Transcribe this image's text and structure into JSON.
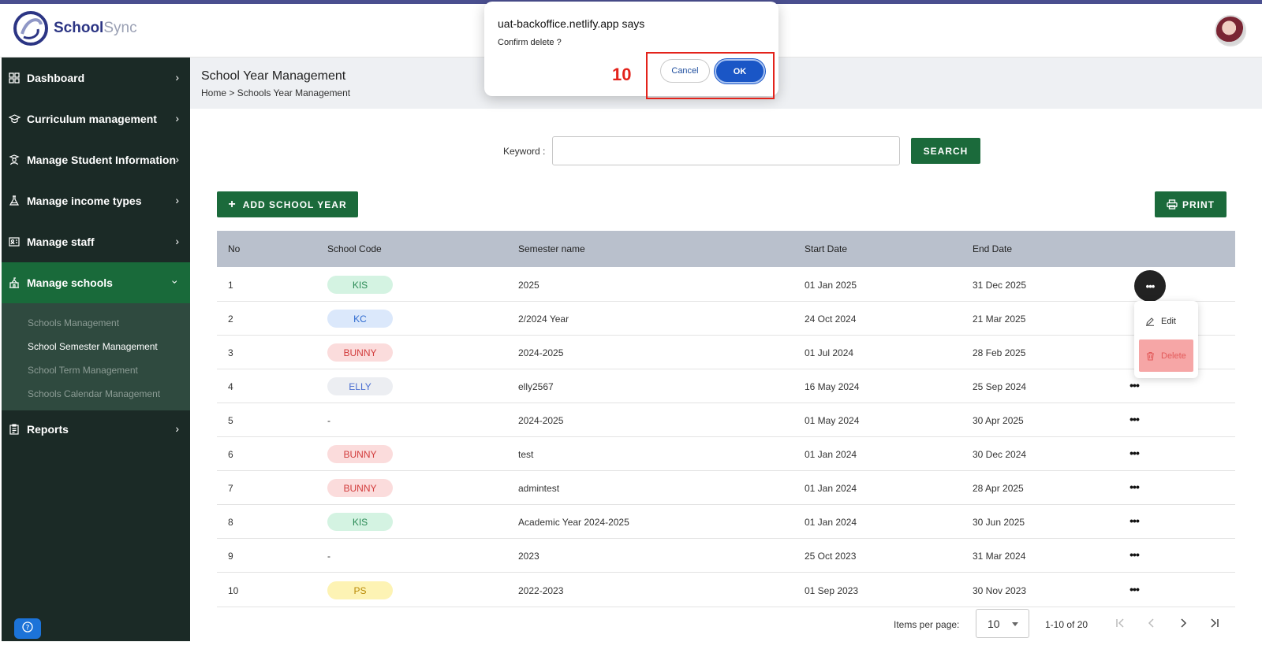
{
  "app": {
    "logo_primary": "School",
    "logo_secondary": "Sync"
  },
  "sidebar": {
    "items": [
      {
        "label": "Dashboard",
        "icon": "grid-icon"
      },
      {
        "label": "Curriculum management",
        "icon": "graduation-cap-icon"
      },
      {
        "label": "Manage Student Information",
        "icon": "student-icon"
      },
      {
        "label": "Manage income types",
        "icon": "flask-icon"
      },
      {
        "label": "Manage staff",
        "icon": "staff-board-icon"
      },
      {
        "label": "Manage schools",
        "icon": "school-icon",
        "active": true
      },
      {
        "label": "Reports",
        "icon": "clipboard-icon"
      }
    ],
    "submenu": [
      {
        "label": "Schools Management"
      },
      {
        "label": "School Semester Management",
        "active": true
      },
      {
        "label": "School Term Management"
      },
      {
        "label": "Schools Calendar Management"
      }
    ]
  },
  "header": {
    "page_title": "School Year Management",
    "breadcrumb": "Home > Schools Year Management"
  },
  "search": {
    "label": "Keyword :",
    "value": "",
    "button": "SEARCH"
  },
  "actions": {
    "add_label": "ADD SCHOOL YEAR",
    "print_label": "PRINT"
  },
  "table": {
    "columns": [
      "No",
      "School Code",
      "Semester name",
      "Start Date",
      "End Date"
    ],
    "rows": [
      {
        "no": "1",
        "code": "KIS",
        "semester": "2025",
        "start": "01 Jan 2025",
        "end": "31 Dec 2025"
      },
      {
        "no": "2",
        "code": "KC",
        "semester": "2/2024 Year",
        "start": "24 Oct 2024",
        "end": "21 Mar 2025"
      },
      {
        "no": "3",
        "code": "BUNNY",
        "semester": "2024-2025",
        "start": "01 Jul 2024",
        "end": "28 Feb 2025"
      },
      {
        "no": "4",
        "code": "ELLY",
        "semester": "elly2567",
        "start": "16 May 2024",
        "end": "25 Sep 2024"
      },
      {
        "no": "5",
        "code": "-",
        "semester": "2024-2025",
        "start": "01 May 2024",
        "end": "30 Apr 2025"
      },
      {
        "no": "6",
        "code": "BUNNY",
        "semester": "test",
        "start": "01 Jan 2024",
        "end": "30 Dec 2024"
      },
      {
        "no": "7",
        "code": "BUNNY",
        "semester": "admintest",
        "start": "01 Jan 2024",
        "end": "28 Apr 2025"
      },
      {
        "no": "8",
        "code": "KIS",
        "semester": "Academic Year 2024-2025",
        "start": "01 Jan 2024",
        "end": "30 Jun 2025"
      },
      {
        "no": "9",
        "code": "-",
        "semester": "2023",
        "start": "25 Oct 2023",
        "end": "31 Mar 2024"
      },
      {
        "no": "10",
        "code": "PS",
        "semester": "2022-2023",
        "start": "01 Sep 2023",
        "end": "30 Nov 2023"
      }
    ]
  },
  "row_menu": {
    "edit_label": "Edit",
    "delete_label": "Delete"
  },
  "pagination": {
    "label": "Items per page:",
    "per_page": "10",
    "range": "1-10 of 20"
  },
  "dialog": {
    "title": "uat-backoffice.netlify.app says",
    "message": "Confirm delete ?",
    "step_number": "10",
    "cancel_label": "Cancel",
    "ok_label": "OK"
  },
  "colors": {
    "sidebar_bg": "#1b2a26",
    "active_green": "#196a3a",
    "button_green": "#1b6a3b",
    "dialog_ok_blue": "#1a56c6",
    "highlight_red": "#e3231b"
  },
  "pill_colors": {
    "KIS": {
      "bg": "#d4f3e2",
      "fg": "#2a8a55"
    },
    "KC": {
      "bg": "#dbe8fb",
      "fg": "#2f6bd0"
    },
    "BUNNY": {
      "bg": "#fbdcdc",
      "fg": "#d23c3c"
    },
    "ELLY": {
      "bg": "#eceef2",
      "fg": "#4b6fd1"
    },
    "PS": {
      "bg": "#fdf3b4",
      "fg": "#b98a06"
    }
  }
}
